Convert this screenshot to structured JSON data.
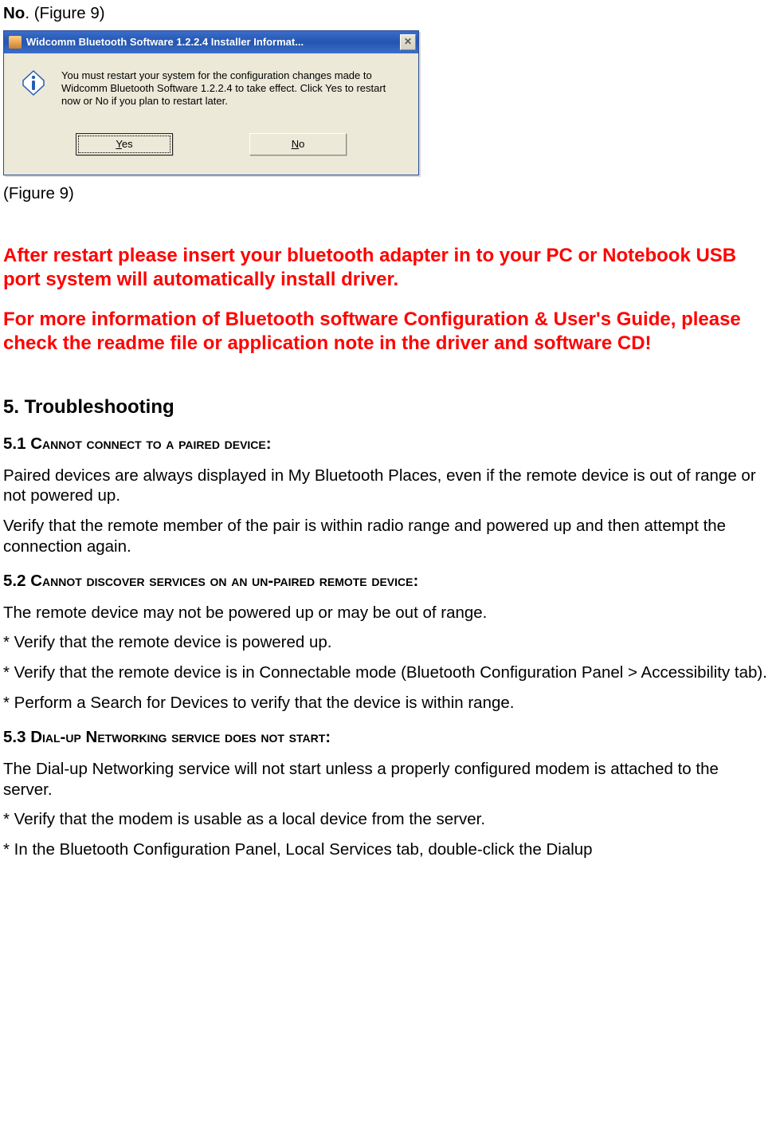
{
  "top_line": {
    "bold": "No",
    "rest": ".   (Figure 9)"
  },
  "dialog": {
    "title": "Widcomm Bluetooth Software 1.2.2.4 Installer Informat...",
    "message": "You must restart your system for the configuration changes made to Widcomm Bluetooth Software 1.2.2.4 to take effect. Click Yes to restart now or No if you plan to restart later.",
    "yes": "Yes",
    "no": "No",
    "close_glyph": "✕"
  },
  "caption": "(Figure 9)",
  "red_notes": {
    "a": "After restart please insert your bluetooth adapter in to your PC or Notebook USB port system will automatically install driver.",
    "b": "For more information of Bluetooth software Configuration & User's Guide, please check the readme file or application note in the driver and software CD!"
  },
  "sections": {
    "main": "5. Troubleshooting",
    "s51_num": "5.1 ",
    "s51_t": "Cannot connect to a paired device:",
    "s51_p1": "Paired devices are always displayed in My Bluetooth Places, even if the remote device is out of range or not powered up.",
    "s51_p2": "Verify that the remote member of the pair is within radio range and powered up and then attempt the connection again.",
    "s52_num": "5.2 ",
    "s52_t": "Cannot discover services on an un-paired remote device:",
    "s52_p1": "The remote device may not be powered up or may be out of range.",
    "s52_b1": "* Verify that the remote device is powered up.",
    "s52_b2": "* Verify that the remote device is in Connectable mode (Bluetooth Configuration Panel > Accessibility tab).",
    "s52_b3": "* Perform a Search for Devices to verify that the device is within range.",
    "s53_num": "5.3 ",
    "s53_t": "Dial-up Networking service does not start:",
    "s53_p1": "The Dial-up Networking service will not start unless a properly configured modem is attached to the server.",
    "s53_b1": "* Verify that the modem is usable as a local device from the server.",
    "s53_b2": "* In the Bluetooth Configuration Panel, Local Services tab, double-click the Dialup"
  }
}
